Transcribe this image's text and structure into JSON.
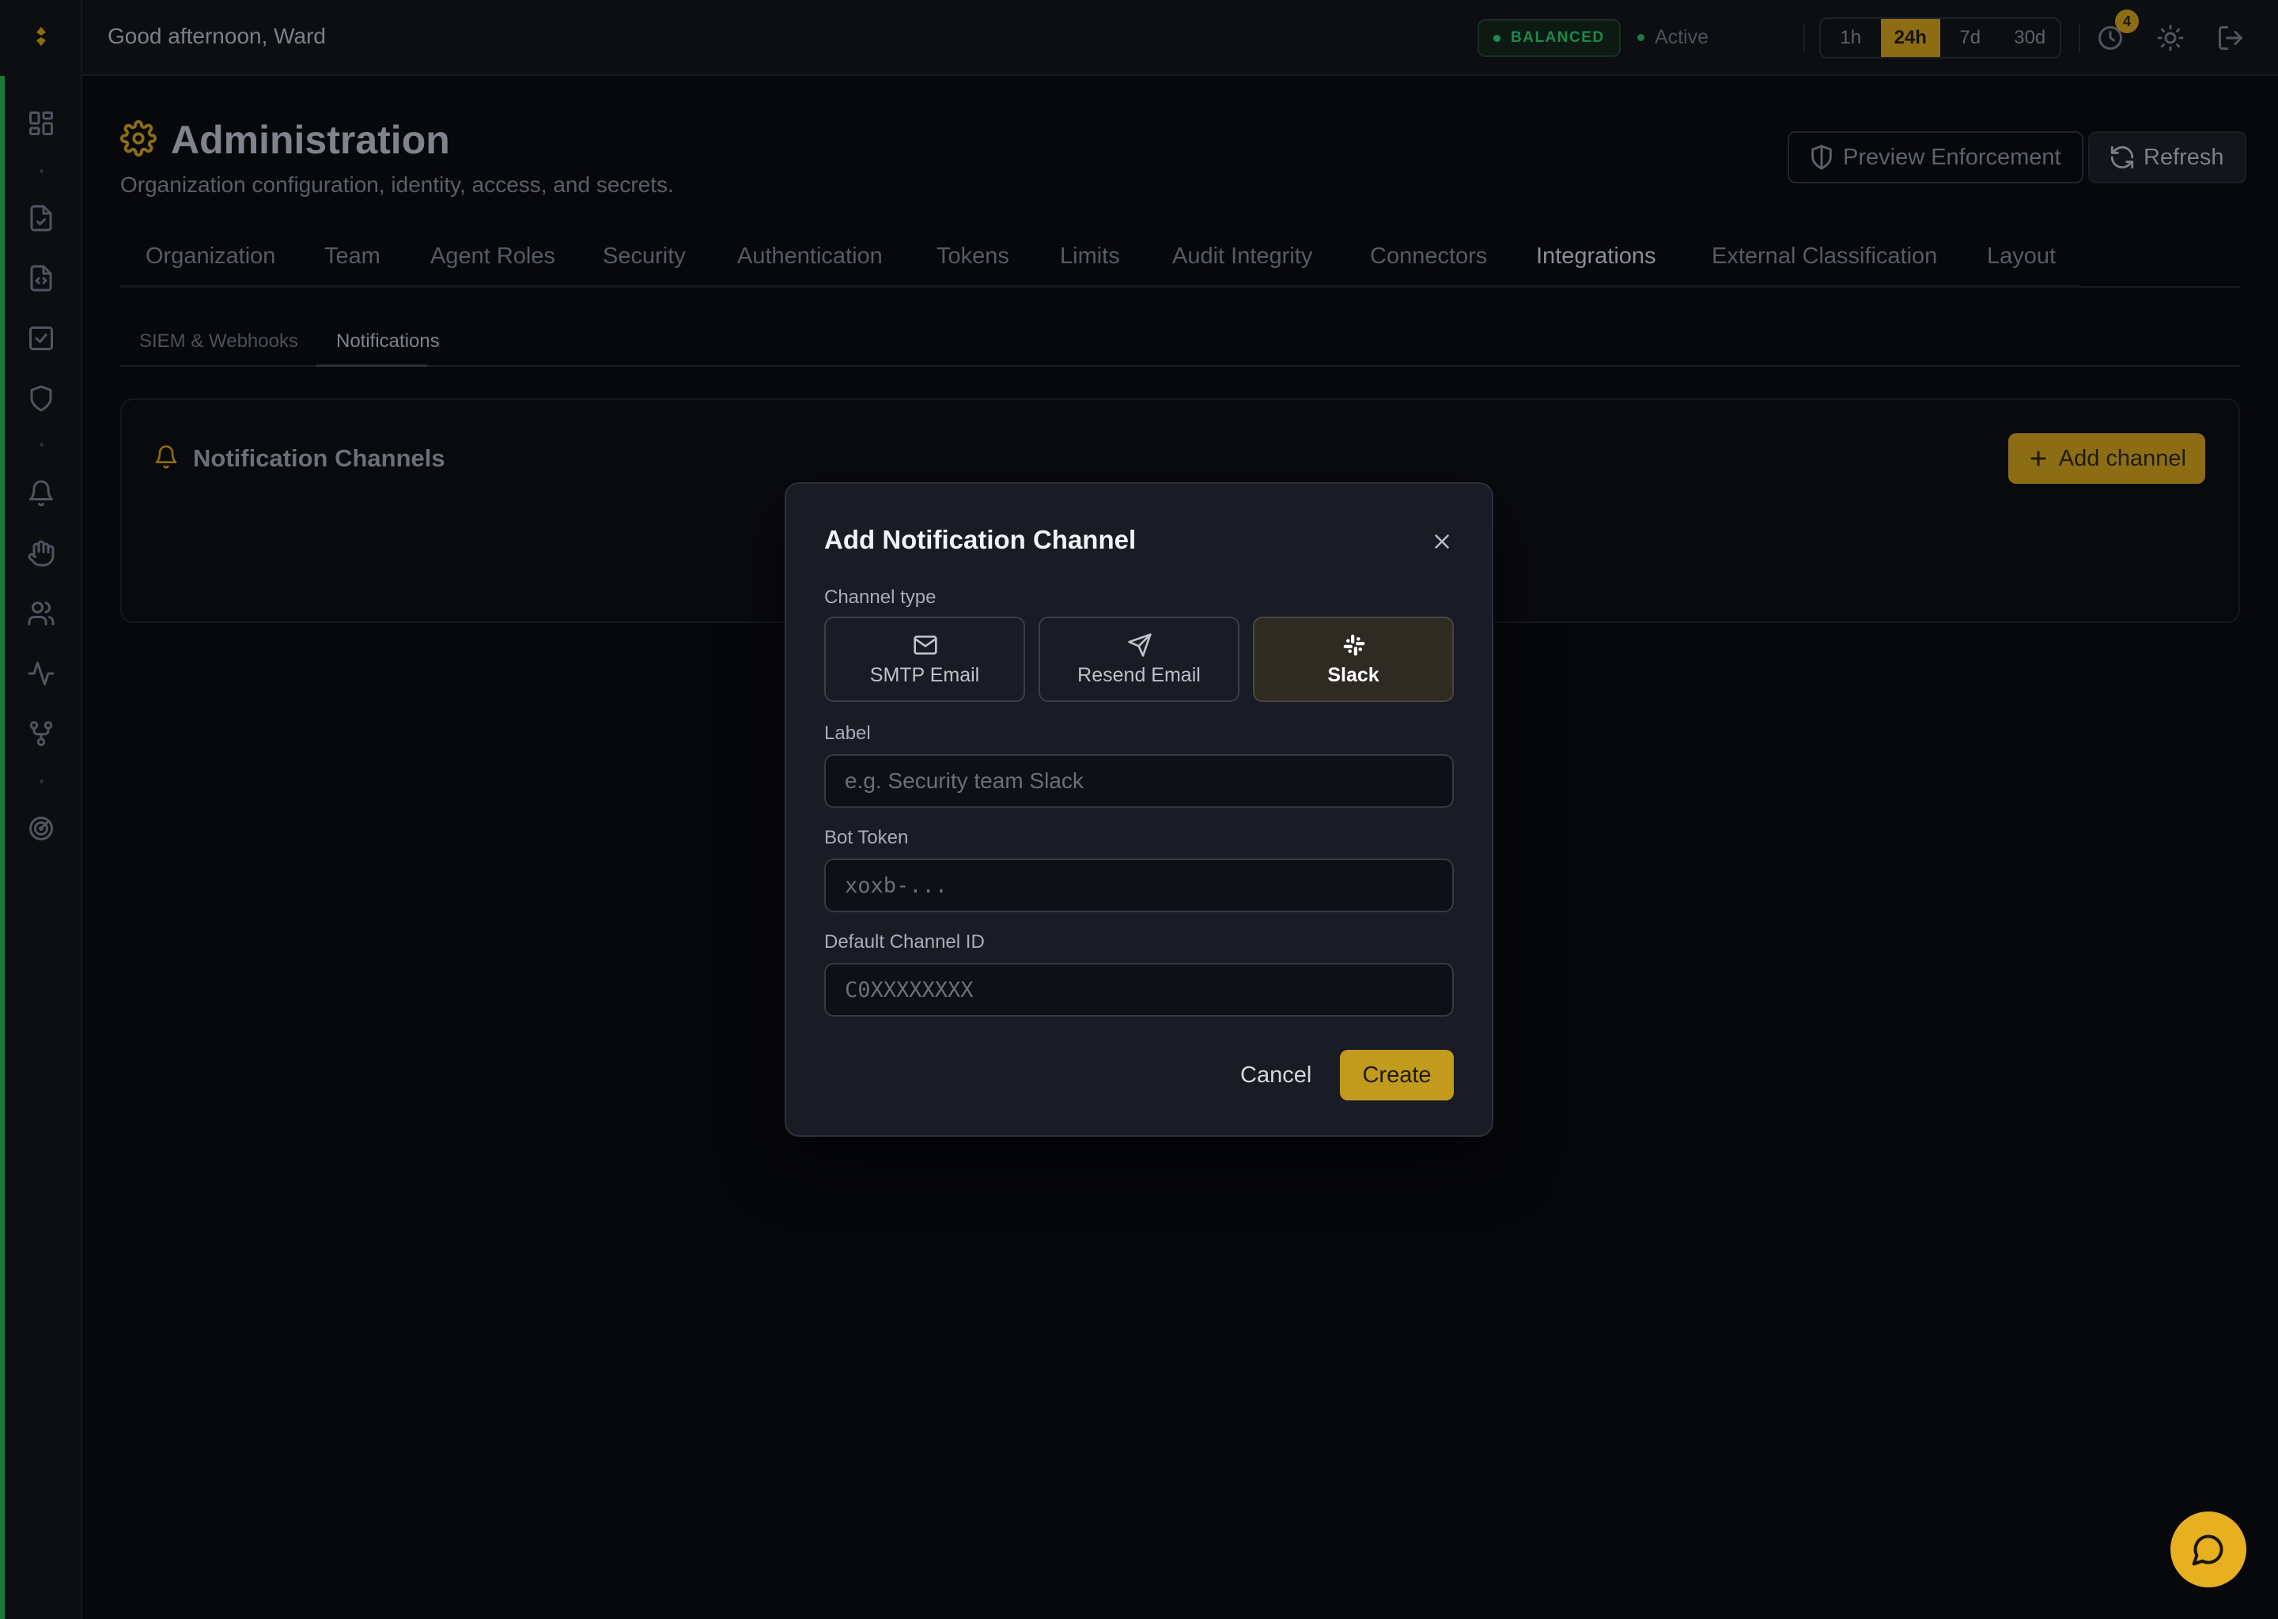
{
  "topbar": {
    "greeting": "Good afternoon, Ward",
    "mode_badge": "BALANCED",
    "status": "Active",
    "time_ranges": [
      "1h",
      "24h",
      "7d",
      "30d"
    ],
    "active_range": "24h",
    "notification_count": "4"
  },
  "page": {
    "title": "Administration",
    "subtitle": "Organization configuration, identity, access, and secrets.",
    "preview_button": "Preview Enforcement",
    "refresh_button": "Refresh"
  },
  "tabs": [
    "Organization",
    "Team",
    "Agent Roles",
    "Security",
    "Authentication",
    "Tokens",
    "Limits",
    "Audit Integrity",
    "Connectors",
    "Integrations",
    "External Classification",
    "Layout"
  ],
  "active_tab": "Integrations",
  "subtabs": [
    "SIEM & Webhooks",
    "Notifications"
  ],
  "active_subtab": "Notifications",
  "card": {
    "title": "Notification Channels",
    "add_button": "Add channel"
  },
  "modal": {
    "title": "Add Notification Channel",
    "channel_type_label": "Channel type",
    "channel_types": [
      {
        "label": "SMTP Email",
        "icon": "mail-icon"
      },
      {
        "label": "Resend Email",
        "icon": "send-icon"
      },
      {
        "label": "Slack",
        "icon": "slack-icon"
      }
    ],
    "selected_type": "Slack",
    "fields": {
      "label": {
        "label": "Label",
        "placeholder": "e.g. Security team Slack",
        "value": ""
      },
      "bot_token": {
        "label": "Bot Token",
        "placeholder": "xoxb-...",
        "value": ""
      },
      "channel_id": {
        "label": "Default Channel ID",
        "placeholder": "C0XXXXXXXX",
        "value": ""
      }
    },
    "cancel_button": "Cancel",
    "create_button": "Create"
  },
  "colors": {
    "accent": "#8d6d14",
    "accent_bright": "#c19a1e",
    "fab": "#e6b021",
    "status_green": "#1e8a4c",
    "background": "#07080b"
  }
}
